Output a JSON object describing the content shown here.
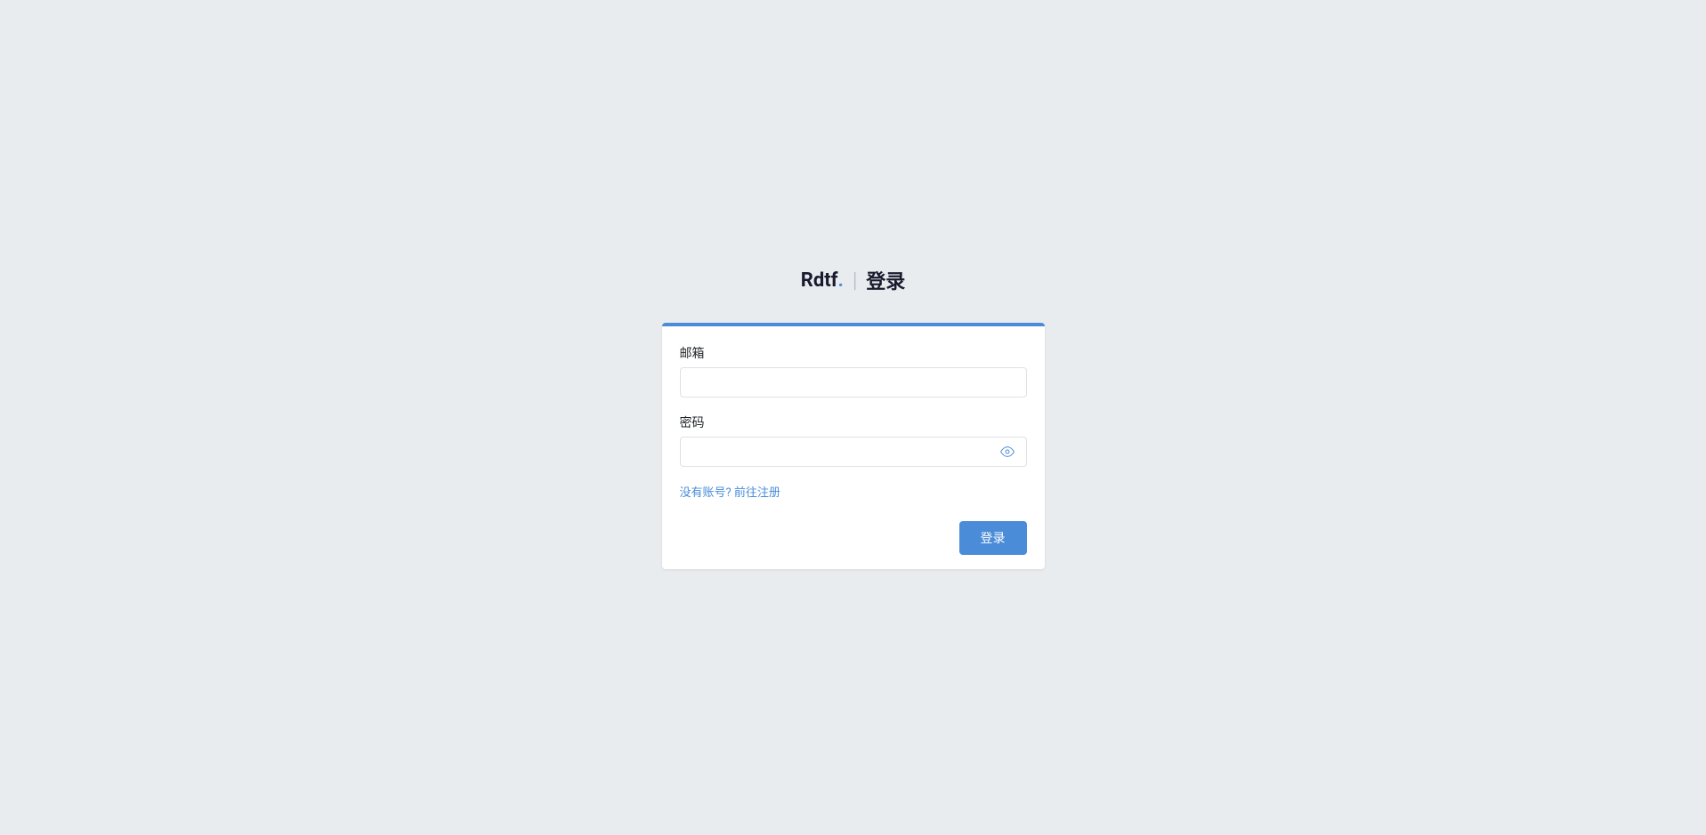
{
  "header": {
    "brand_name": "Rdtf",
    "brand_dot": ".",
    "divider": "|",
    "page_name": "登录"
  },
  "form": {
    "email": {
      "label": "邮箱",
      "value": ""
    },
    "password": {
      "label": "密码",
      "value": ""
    },
    "register_link": "没有账号? 前往注册",
    "login_button": "登录"
  },
  "colors": {
    "accent": "#4a8cd8",
    "background": "#e9ecef",
    "card_background": "#ffffff",
    "text_primary": "#1a1a2e",
    "text_secondary": "#212529",
    "border": "#dee2e6"
  }
}
